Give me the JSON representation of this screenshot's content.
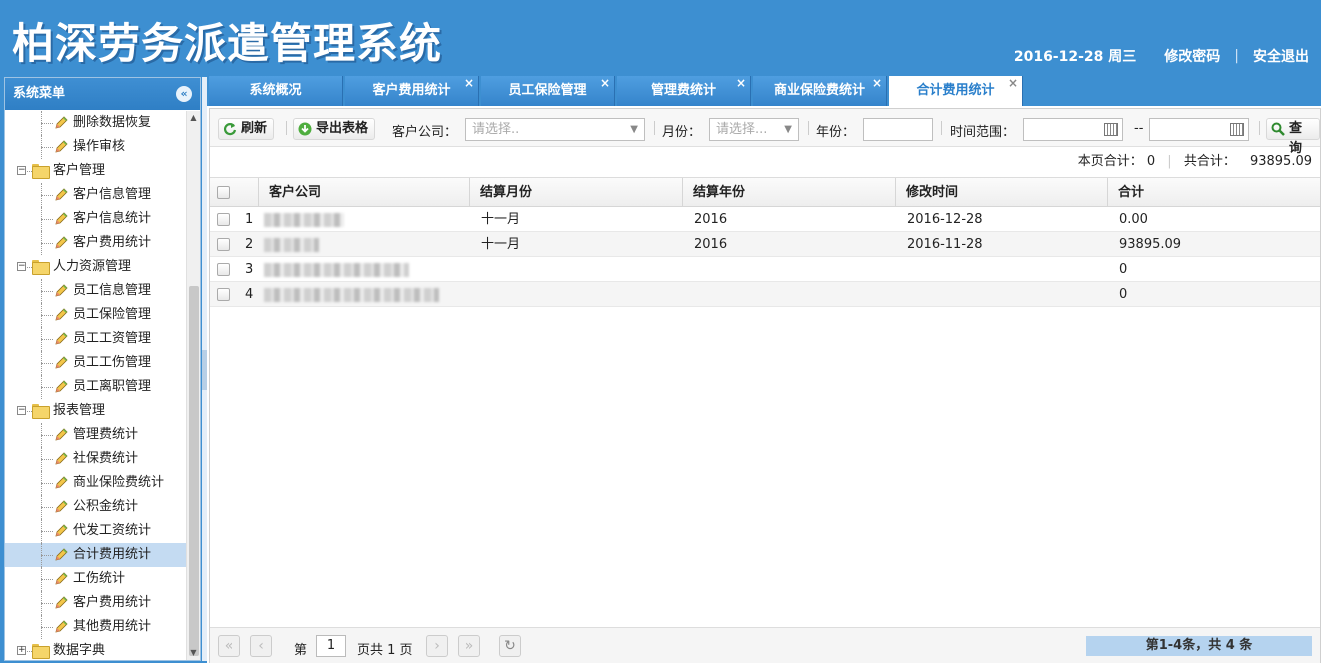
{
  "header": {
    "title": "柏深劳务派遣管理系统",
    "date": "2016-12-28 周三",
    "change_password": "修改密码",
    "separator": "|",
    "logout": "安全退出"
  },
  "sidebar": {
    "title": "系统菜单",
    "collapse_icon": "double-chevron-left-icon",
    "tree": [
      {
        "label": "删除数据恢复",
        "type": "leaf"
      },
      {
        "label": "操作审核",
        "type": "leaf"
      },
      {
        "label": "客户管理",
        "type": "parent",
        "toggle": "−"
      },
      {
        "label": "客户信息管理",
        "type": "leaf"
      },
      {
        "label": "客户信息统计",
        "type": "leaf"
      },
      {
        "label": "客户费用统计",
        "type": "leaf"
      },
      {
        "label": "人力资源管理",
        "type": "parent",
        "toggle": "−"
      },
      {
        "label": "员工信息管理",
        "type": "leaf"
      },
      {
        "label": "员工保险管理",
        "type": "leaf"
      },
      {
        "label": "员工工资管理",
        "type": "leaf"
      },
      {
        "label": "员工工伤管理",
        "type": "leaf"
      },
      {
        "label": "员工离职管理",
        "type": "leaf"
      },
      {
        "label": "报表管理",
        "type": "parent",
        "toggle": "−"
      },
      {
        "label": "管理费统计",
        "type": "leaf"
      },
      {
        "label": "社保费统计",
        "type": "leaf"
      },
      {
        "label": "商业保险费统计",
        "type": "leaf"
      },
      {
        "label": "公积金统计",
        "type": "leaf"
      },
      {
        "label": "代发工资统计",
        "type": "leaf"
      },
      {
        "label": "合计费用统计",
        "type": "leaf",
        "selected": true
      },
      {
        "label": "工伤统计",
        "type": "leaf"
      },
      {
        "label": "客户费用统计",
        "type": "leaf"
      },
      {
        "label": "其他费用统计",
        "type": "leaf"
      },
      {
        "label": "数据字典",
        "type": "parent",
        "toggle": "+"
      }
    ]
  },
  "tabs": [
    {
      "label": "系统概况",
      "closable": false,
      "active": false
    },
    {
      "label": "客户费用统计",
      "closable": true,
      "active": false
    },
    {
      "label": "员工保险管理",
      "closable": true,
      "active": false
    },
    {
      "label": "管理费统计",
      "closable": true,
      "active": false
    },
    {
      "label": "商业保险费统计",
      "closable": true,
      "active": false
    },
    {
      "label": "合计费用统计",
      "closable": true,
      "active": true
    }
  ],
  "tab_close_glyph": "×",
  "toolbar": {
    "refresh_label": "刷新",
    "export_label": "导出表格",
    "company_label": "客户公司：",
    "company_placeholder": "请选择..",
    "month_label": "月份：",
    "month_placeholder": "请选择...",
    "year_label": "年份：",
    "year_value": "",
    "range_label": "时间范围：",
    "range_start": "",
    "range_dash": "--",
    "range_end": "",
    "query_label": "查询"
  },
  "summary": {
    "page_total_label": "本页合计：",
    "page_total_value": "0",
    "separator": "|",
    "grand_total_label": "共合计：",
    "grand_total_value": "93895.09"
  },
  "grid": {
    "columns": [
      "客户公司",
      "结算月份",
      "结算年份",
      "修改时间",
      "合计"
    ],
    "rows": [
      {
        "num": "1",
        "month": "十一月",
        "year": "2016",
        "modified": "2016-12-28",
        "total": "0.00"
      },
      {
        "num": "2",
        "month": "十一月",
        "year": "2016",
        "modified": "2016-11-28",
        "total": "93895.09"
      },
      {
        "num": "3",
        "month": "",
        "year": "",
        "modified": "",
        "total": "0"
      },
      {
        "num": "4",
        "month": "",
        "year": "",
        "modified": "",
        "total": "0"
      }
    ]
  },
  "pager": {
    "page_prefix": "第",
    "current_page": "1",
    "page_suffix": "页共 1 页",
    "info": "第1-4条，共 4 条"
  }
}
